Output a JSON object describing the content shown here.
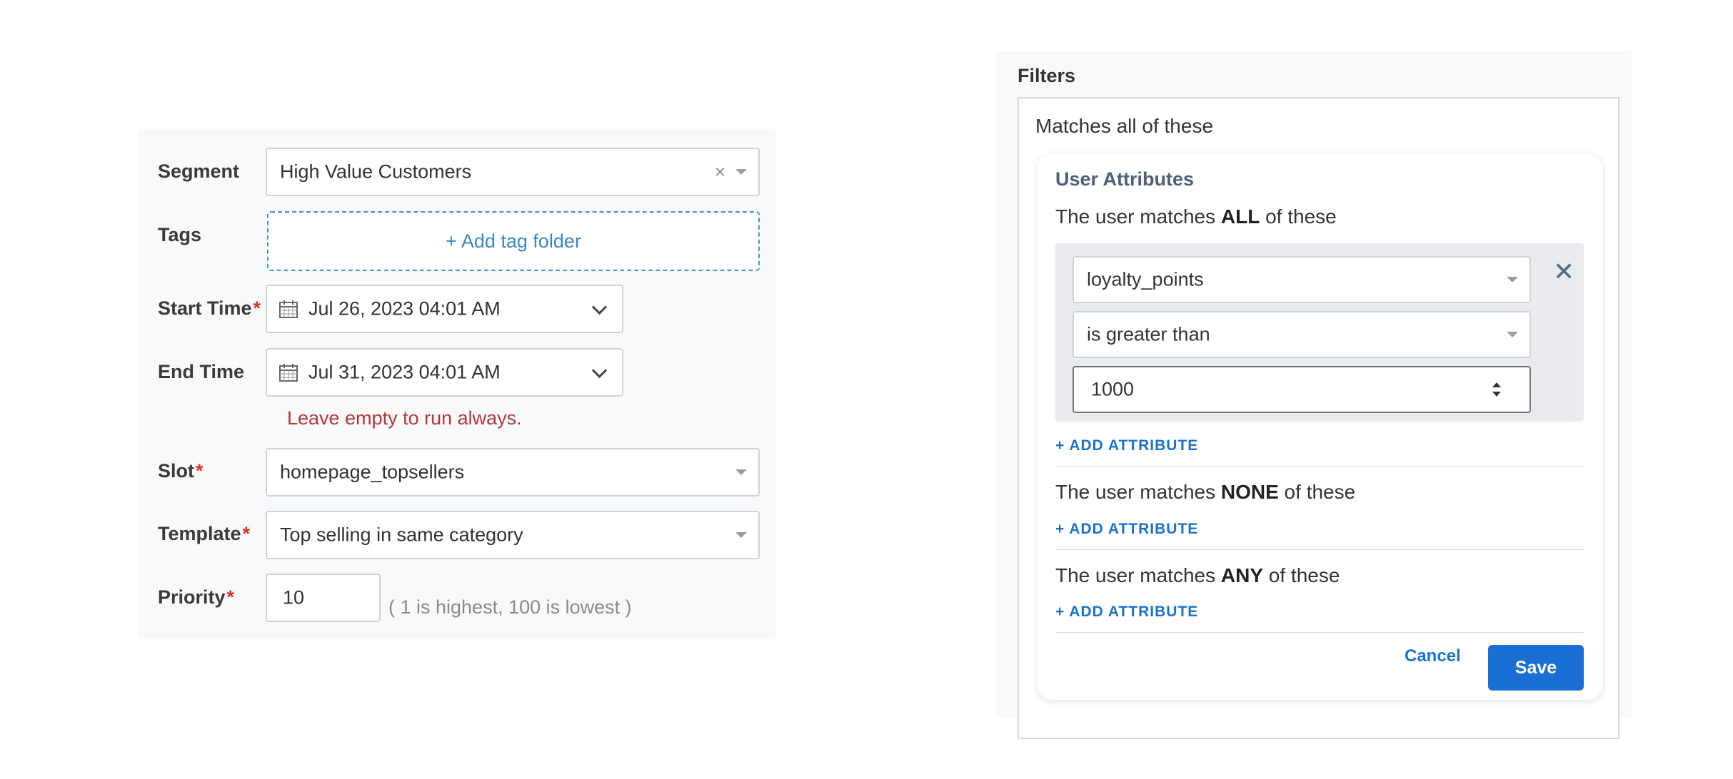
{
  "form": {
    "segment": {
      "label": "Segment",
      "value": "High Value Customers",
      "clear_glyph": "×"
    },
    "tags": {
      "label": "Tags",
      "add_label": "+ Add tag folder"
    },
    "start_time": {
      "label": "Start Time",
      "required": "*",
      "value": "Jul 26, 2023 04:01 AM"
    },
    "end_time": {
      "label": "End Time",
      "value": "Jul 31, 2023 04:01 AM",
      "hint": "Leave empty to run always."
    },
    "slot": {
      "label": "Slot",
      "required": "*",
      "value": "homepage_topsellers"
    },
    "template": {
      "label": "Template",
      "required": "*",
      "value": "Top selling in same category"
    },
    "priority": {
      "label": "Priority",
      "required": "*",
      "value": "10",
      "hint": "( 1 is highest, 100 is lowest )"
    }
  },
  "filters": {
    "title": "Filters",
    "matches_all": "Matches all of these",
    "card": {
      "title": "User Attributes",
      "all_rule": {
        "prefix": "The user matches ",
        "keyword": "ALL",
        "suffix": " of these"
      },
      "condition": {
        "attribute": "loyalty_points",
        "operator": "is greater than",
        "value": "1000",
        "remove_glyph": "✕"
      },
      "none_rule": {
        "prefix": "The user matches ",
        "keyword": "NONE",
        "suffix": " of these"
      },
      "any_rule": {
        "prefix": "The user matches ",
        "keyword": "ANY",
        "suffix": " of these"
      },
      "add_attribute": "+ ADD ATTRIBUTE",
      "cancel": "Cancel",
      "save": "Save"
    }
  },
  "colors": {
    "accent": "#1a73c9",
    "save_bg": "#1a6fd6",
    "error": "#b23a3a",
    "required": "#d93025",
    "tags_border": "#4a90c8"
  },
  "icons": [
    "calendar-icon",
    "chevron-down-icon",
    "caret-down-icon",
    "clear-icon",
    "close-icon",
    "spinner-icon"
  ]
}
